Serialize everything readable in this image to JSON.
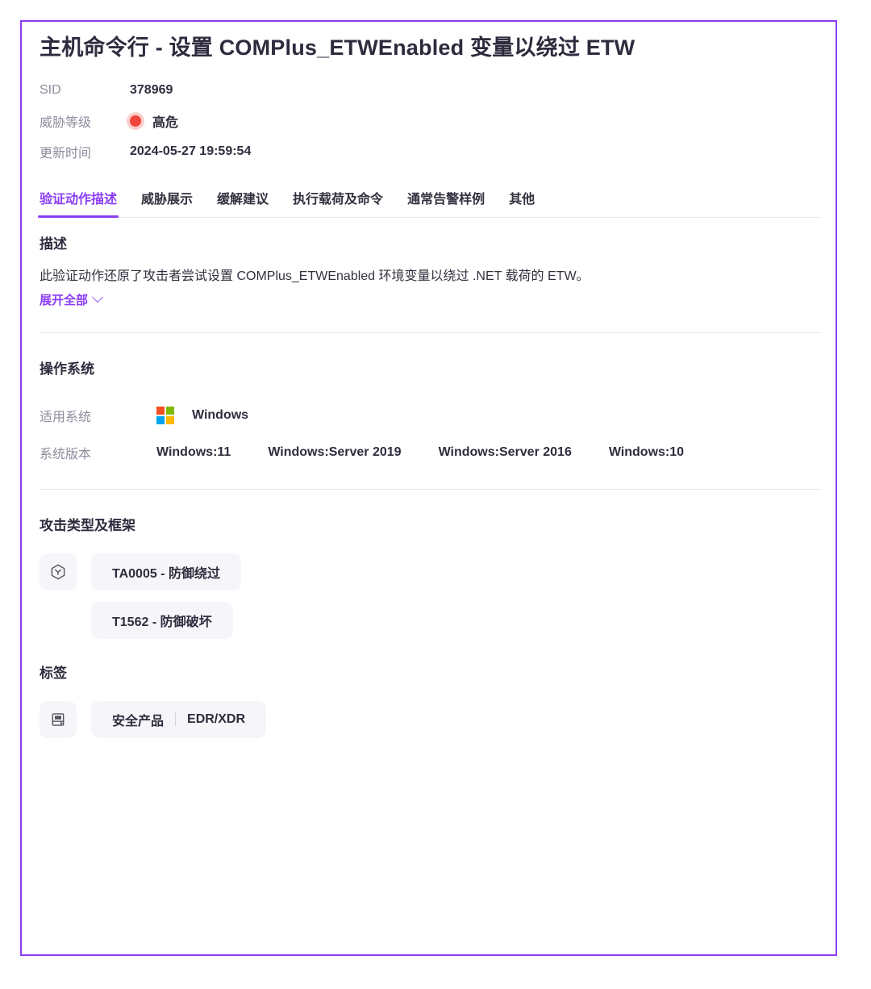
{
  "header": {
    "title": "主机命令行 - 设置 COMPlus_ETWEnabled 变量以绕过 ETW",
    "meta": [
      {
        "label": "SID",
        "value": "378969",
        "type": "text"
      },
      {
        "label": "威胁等级",
        "value": "高危",
        "type": "threat",
        "dot_color": "#f0453a"
      },
      {
        "label": "更新时间",
        "value": "2024-05-27 19:59:54",
        "type": "text"
      }
    ]
  },
  "tabs": [
    {
      "label": "验证动作描述",
      "active": true
    },
    {
      "label": "威胁展示",
      "active": false
    },
    {
      "label": "缓解建议",
      "active": false
    },
    {
      "label": "执行载荷及命令",
      "active": false
    },
    {
      "label": "通常告警样例",
      "active": false
    },
    {
      "label": "其他",
      "active": false
    }
  ],
  "description": {
    "heading": "描述",
    "body": "此验证动作还原了攻击者尝试设置 COMPlus_ETWEnabled 环境变量以绕过 .NET 载荷的 ETW。",
    "expand_label": "展开全部",
    "expand_icon": "chevron-down-icon"
  },
  "os": {
    "heading": "操作系统",
    "applicable_label": "适用系统",
    "applicable_value": "Windows",
    "applicable_icon": "windows-logo-icon",
    "version_label": "系统版本",
    "versions": [
      "Windows:11",
      "Windows:Server 2019",
      "Windows:Server 2016",
      "Windows:10"
    ]
  },
  "attack": {
    "heading": "攻击类型及框架",
    "icon": "hexagon-attack-icon",
    "tactic": "TA0005 - 防御绕过",
    "technique": "T1562 - 防御破坏"
  },
  "tags": {
    "heading": "标签",
    "icon": "save-tag-icon",
    "category": "安全产品",
    "value": "EDR/XDR"
  },
  "theme": {
    "accent": "#8b3df5",
    "title_color": "#2d2b3d",
    "label_color": "#8e8c9b",
    "chip_bg": "#f6f5f9",
    "divider": "#e9e7ef"
  }
}
